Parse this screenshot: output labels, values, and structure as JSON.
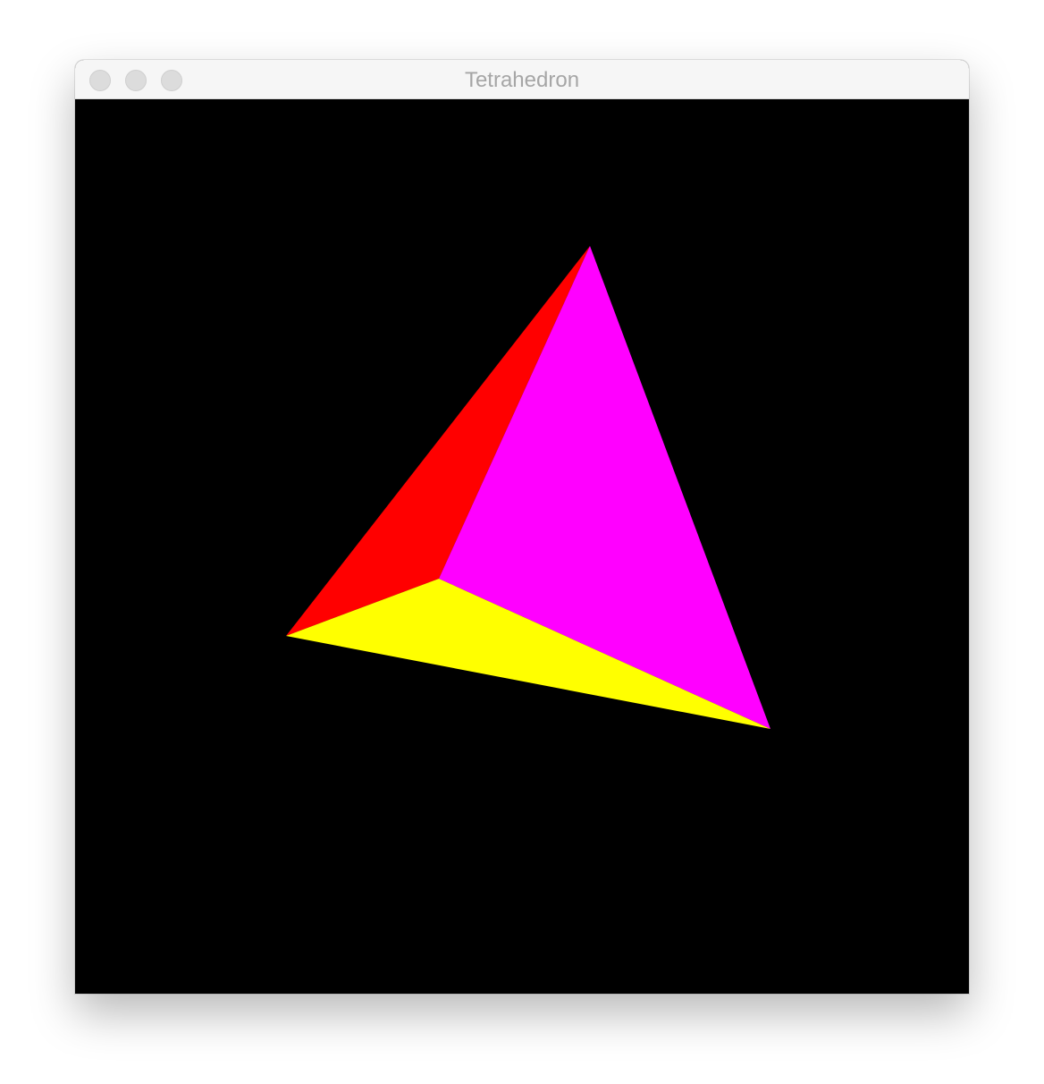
{
  "window": {
    "title": "Tetrahedron"
  },
  "titlebar": {
    "buttons": [
      {
        "name": "close",
        "color": "#dcdcdc"
      },
      {
        "name": "minimize",
        "color": "#dcdcdc"
      },
      {
        "name": "zoom",
        "color": "#dcdcdc"
      }
    ]
  },
  "scene": {
    "background": "#000000",
    "faces": [
      {
        "name": "red-face",
        "color": "#ff0000"
      },
      {
        "name": "magenta-face",
        "color": "#ff00ff"
      },
      {
        "name": "yellow-face",
        "color": "#ffff00"
      }
    ]
  }
}
